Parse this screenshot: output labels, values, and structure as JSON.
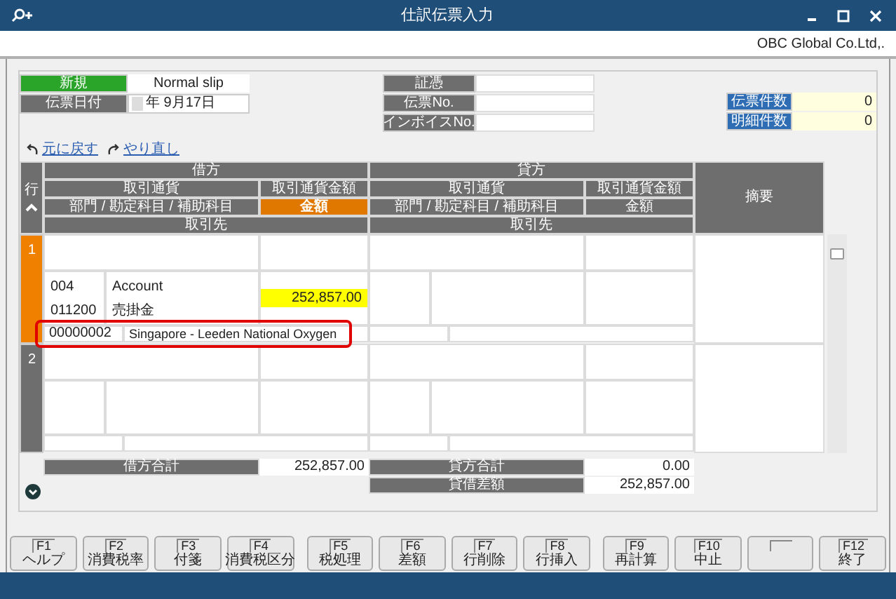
{
  "window": {
    "title": "仕訳伝票入力",
    "company": "OBC Global Co.Ltd,."
  },
  "header": {
    "status": "新規",
    "slip_type": "Normal slip",
    "date_label": "伝票日付",
    "date_value": "年  9月17日",
    "fields": [
      {
        "label": "証憑"
      },
      {
        "label": "伝票No."
      },
      {
        "label": "インボイスNo."
      }
    ],
    "counts": [
      {
        "label": "伝票件数",
        "value": "0"
      },
      {
        "label": "明細件数",
        "value": "0"
      }
    ]
  },
  "undo": "元に戻す",
  "redo": "やり直し",
  "grid": {
    "row_label": "行",
    "sides": [
      {
        "title": "借方",
        "currency": "取引通貨",
        "currency_amount": "取引通貨金額",
        "account": "部門 / 勘定科目 / 補助科目",
        "amount": "金額",
        "amount_selected": true,
        "partner": "取引先"
      },
      {
        "title": "貸方",
        "currency": "取引通貨",
        "currency_amount": "取引通貨金額",
        "account": "部門 / 勘定科目 / 補助科目",
        "amount": "金額",
        "amount_selected": false,
        "partner": "取引先"
      }
    ],
    "memo": "摘要",
    "rows": [
      {
        "number": "1",
        "selected": true,
        "debit": {
          "dept_code": "004",
          "dept_name": "Account",
          "account_code": "011200",
          "account_name": "売掛金",
          "amount": "252,857.00",
          "amount_focused": true,
          "partner_code": "00000002",
          "partner_name": "Singapore - Leeden National Oxygen",
          "highlighted": true
        }
      },
      {
        "number": "2",
        "selected": false
      }
    ]
  },
  "totals": {
    "debit_label": "借方合計",
    "debit_value": "252,857.00",
    "credit_label": "貸方合計",
    "credit_value": "0.00",
    "diff_label": "貸借差額",
    "diff_value": "252,857.00"
  },
  "function_keys": [
    {
      "key": "F1",
      "label": "ヘルプ"
    },
    {
      "key": "F2",
      "label": "消費税率"
    },
    {
      "key": "F3",
      "label": "付箋"
    },
    {
      "key": "F4",
      "label": "消費税区分"
    },
    {
      "key": "F5",
      "label": "税処理"
    },
    {
      "key": "F6",
      "label": "差額"
    },
    {
      "key": "F7",
      "label": "行削除"
    },
    {
      "key": "F8",
      "label": "行挿入"
    },
    {
      "key": "F9",
      "label": "再計算"
    },
    {
      "key": "F10",
      "label": "中止"
    },
    {
      "kind": "blank"
    },
    {
      "key": "F12",
      "label": "終了"
    }
  ]
}
